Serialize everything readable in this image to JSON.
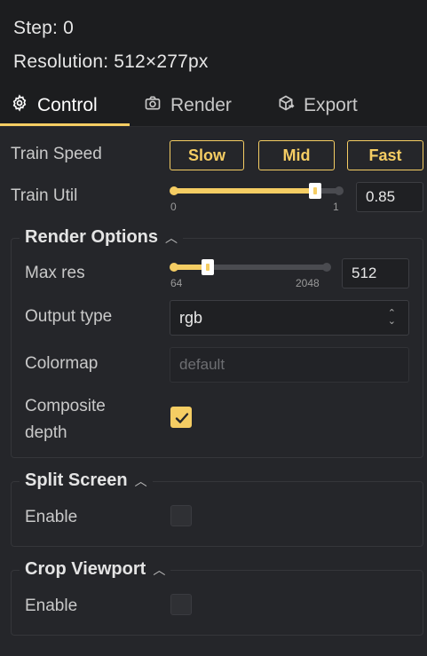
{
  "status": {
    "step": "Step: 0",
    "resolution": "Resolution: 512×277px"
  },
  "tabs": [
    {
      "label": "Control",
      "icon": "gear-icon",
      "active": true
    },
    {
      "label": "Render",
      "icon": "camera-icon",
      "active": false
    },
    {
      "label": "Export",
      "icon": "package-export-icon",
      "active": false
    }
  ],
  "control": {
    "train_speed": {
      "label": "Train Speed",
      "buttons": [
        "Slow",
        "Mid",
        "Fast"
      ]
    },
    "train_util": {
      "label": "Train Util",
      "min_label": "0",
      "max_label": "1",
      "value": "0.85",
      "fraction": 0.85
    },
    "render_options": {
      "title": "Render Options",
      "max_res": {
        "label": "Max res",
        "min_label": "64",
        "max_label": "2048",
        "value": "512",
        "fraction": 0.226
      },
      "output_type": {
        "label": "Output type",
        "value": "rgb"
      },
      "colormap": {
        "label": "Colormap",
        "placeholder": "default"
      },
      "composite_depth": {
        "label_line1": "Composite",
        "label_line2": "depth",
        "checked": true
      }
    },
    "split_screen": {
      "title": "Split Screen",
      "enable_label": "Enable",
      "checked": false
    },
    "crop_viewport": {
      "title": "Crop Viewport",
      "enable_label": "Enable",
      "checked": false
    }
  },
  "colors": {
    "accent": "#f5cd63",
    "background": "#25262a",
    "header_background": "#1c1d1f"
  }
}
